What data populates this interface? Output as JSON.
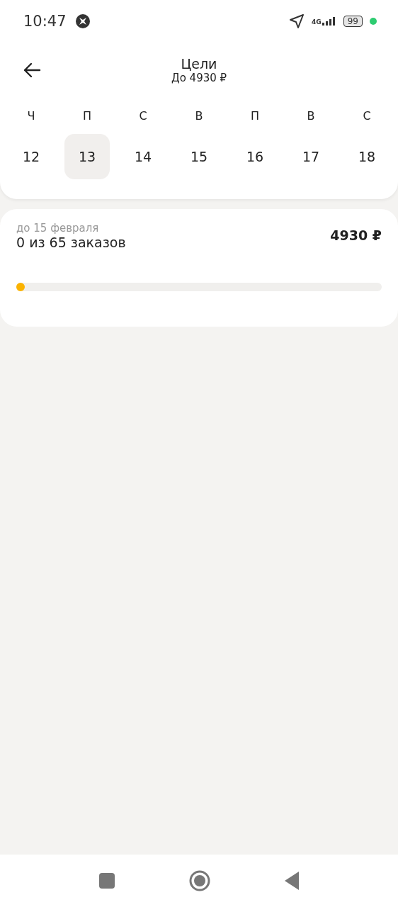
{
  "status_bar": {
    "time": "10:47",
    "network": "4G",
    "battery": "99"
  },
  "header": {
    "title": "Цели",
    "subtitle": "До 4930 ₽"
  },
  "days": [
    {
      "weekday": "Ч",
      "date": "12",
      "selected": false
    },
    {
      "weekday": "П",
      "date": "13",
      "selected": true
    },
    {
      "weekday": "С",
      "date": "14",
      "selected": false
    },
    {
      "weekday": "В",
      "date": "15",
      "selected": false
    },
    {
      "weekday": "П",
      "date": "16",
      "selected": false
    },
    {
      "weekday": "В",
      "date": "17",
      "selected": false
    },
    {
      "weekday": "С",
      "date": "18",
      "selected": false
    }
  ],
  "goal": {
    "deadline": "до 15 февраля",
    "progress_text": "0 из 65 заказов",
    "amount": "4930 ₽",
    "level": 0
  }
}
